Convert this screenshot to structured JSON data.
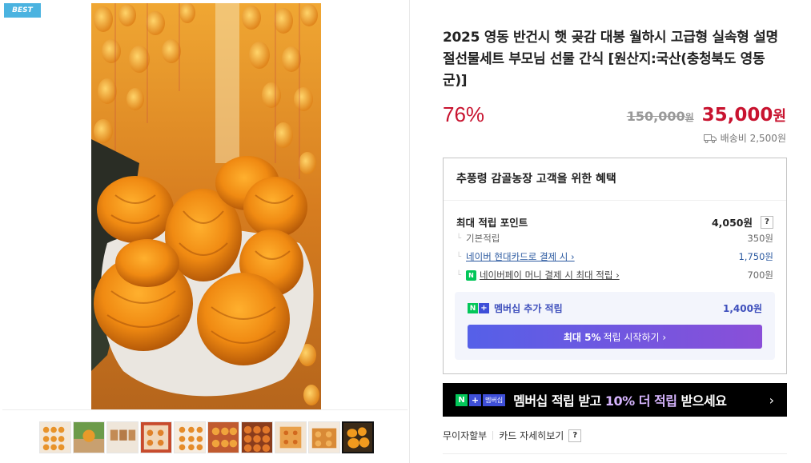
{
  "image_area": {
    "badge": "BEST",
    "main_photo_icon": "dried-persimmon-photo",
    "thumbnail_count": 10
  },
  "product": {
    "title": "2025 영동 반건시 햇 곶감 대봉 월하시 고급형 실속형 설명절선물세트 부모님 선물 간식 [원산지:국산(충청북도 영동군)]",
    "discount": "76%",
    "original_price": "150,000",
    "original_price_unit": "원",
    "sale_price": "35,000",
    "sale_price_unit": "원",
    "shipping": "배송비 2,500원"
  },
  "benefits": {
    "title": "추풍령 감골농장 고객을 위한 혜택",
    "max_points_label": "최대 적립 포인트",
    "max_points_value": "4,050원",
    "help": "?",
    "rows": [
      {
        "label": "기본적립",
        "value": "350원"
      },
      {
        "label": "네이버 현대카드로 결제 시 ›",
        "value": "1,750원"
      },
      {
        "label": "네이버페이 머니 결제 시 최대 적립 ›",
        "value": "700원"
      }
    ],
    "npay_icon_text": "N",
    "membership": {
      "n": "N",
      "plus": "+",
      "label": "멤버십 추가 적립",
      "value": "1,400원",
      "cta_bold": "최대 5%",
      "cta_rest": "적립 시작하기 ›"
    }
  },
  "banner": {
    "n": "N",
    "plus": "+",
    "mem": "멤버십",
    "text_a": "멤버십 적립 받고 ",
    "text_hl": "10% 더 적립",
    "text_b": " 받으세요",
    "arrow": "›"
  },
  "links": {
    "installment": "무이자할부",
    "card_detail": "카드 자세히보기",
    "help": "?"
  },
  "colors": {
    "accent_red": "#c8132f",
    "link_blue": "#2c5aa0",
    "badge_blue": "#4bb3e0",
    "naver_green": "#03c75a"
  }
}
